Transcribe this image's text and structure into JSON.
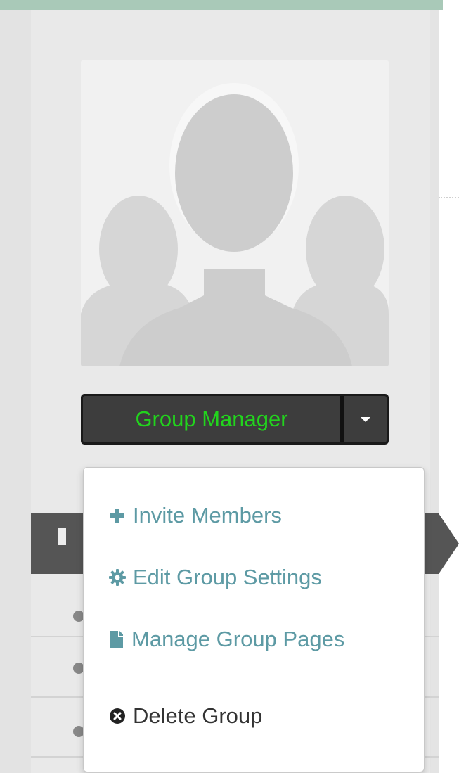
{
  "group": {
    "avatar_icon": "group-silhouette-icon"
  },
  "manager_button": {
    "label": "Group Manager",
    "toggle_icon": "caret-down-icon"
  },
  "menu": {
    "items": [
      {
        "label": "Invite Members",
        "icon": "plus-icon"
      },
      {
        "label": "Edit Group Settings",
        "icon": "gear-icon"
      },
      {
        "label": "Manage Group Pages",
        "icon": "file-icon"
      }
    ],
    "danger_item": {
      "label": "Delete Group",
      "icon": "times-circle-icon"
    }
  },
  "colors": {
    "accent_green": "#22d41d",
    "link_teal": "#5d9aa4",
    "button_dark": "#3d3d3d",
    "nav_dark": "#555555"
  }
}
